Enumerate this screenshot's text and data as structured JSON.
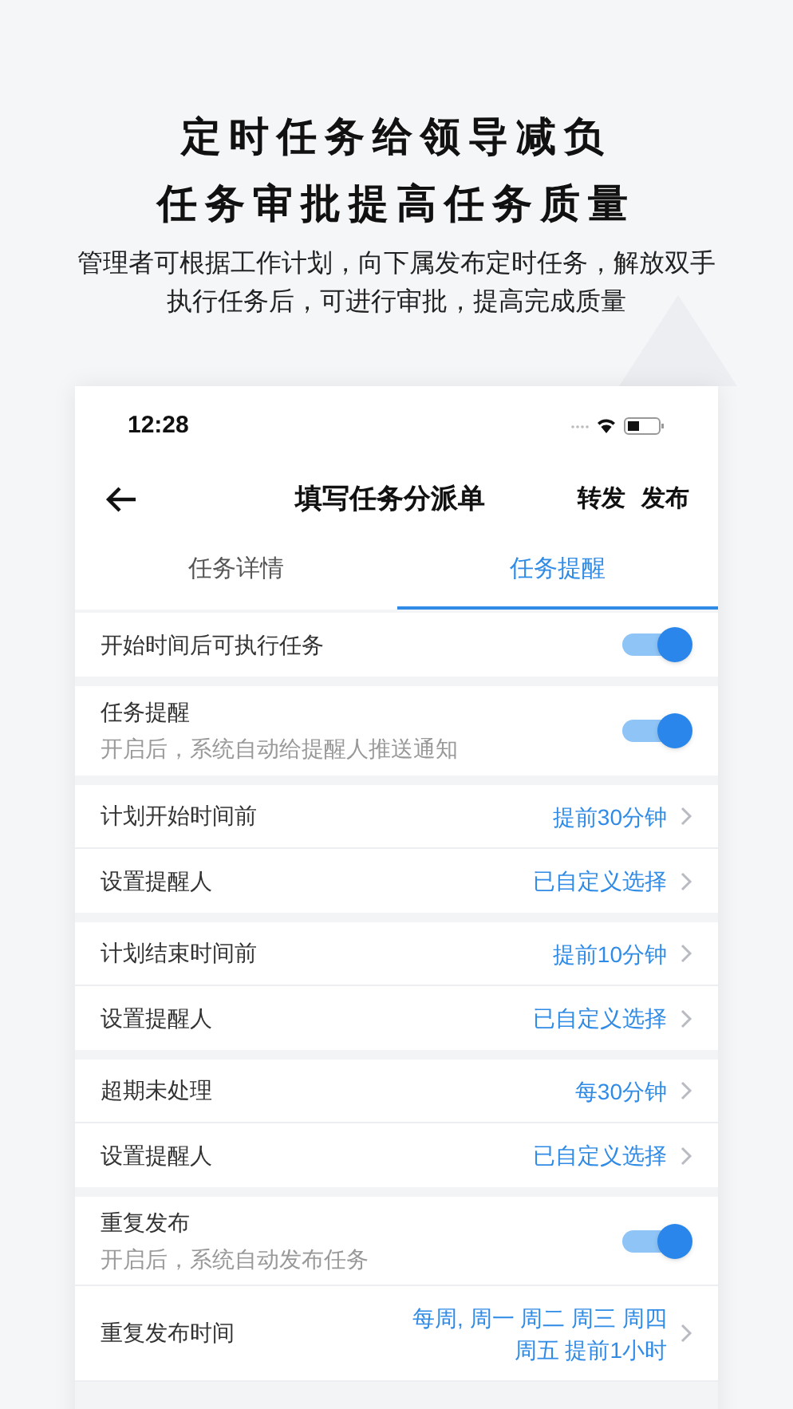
{
  "headline": [
    "定时任务给领导减负",
    "任务审批提高任务质量"
  ],
  "subtitle": [
    "管理者可根据工作计划，向下属发布定时任务，解放双手",
    "执行任务后，可进行审批，提高完成质量"
  ],
  "status_bar": {
    "time": "12:28"
  },
  "nav": {
    "title": "填写任务分派单",
    "actions": [
      "转发",
      "发布"
    ]
  },
  "tabs": [
    {
      "label": "任务详情",
      "selected": false
    },
    {
      "label": "任务提醒",
      "selected": true
    }
  ],
  "sections": [
    {
      "rows": [
        {
          "kind": "toggle",
          "label": "开始时间后可执行任务",
          "on": true
        }
      ]
    },
    {
      "rows": [
        {
          "kind": "toggle",
          "label": "任务提醒",
          "hint": "开启后，系统自动给提醒人推送通知",
          "on": true
        }
      ]
    },
    {
      "rows": [
        {
          "kind": "link",
          "label": "计划开始时间前",
          "value_lines": [
            "提前30分钟"
          ]
        },
        {
          "kind": "link",
          "label": "设置提醒人",
          "value_lines": [
            "已自定义选择"
          ]
        }
      ]
    },
    {
      "rows": [
        {
          "kind": "link",
          "label": "计划结束时间前",
          "value_lines": [
            "提前10分钟"
          ]
        },
        {
          "kind": "link",
          "label": "设置提醒人",
          "value_lines": [
            "已自定义选择"
          ]
        }
      ]
    },
    {
      "rows": [
        {
          "kind": "link",
          "label": "超期未处理",
          "value_lines": [
            "每30分钟"
          ]
        },
        {
          "kind": "link",
          "label": "设置提醒人",
          "value_lines": [
            "已自定义选择"
          ]
        }
      ]
    },
    {
      "rows": [
        {
          "kind": "toggle",
          "label": "重复发布",
          "hint": "开启后，系统自动发布任务",
          "on": true
        },
        {
          "kind": "link",
          "label": "重复发布时间",
          "value_lines": [
            "每周, 周一 周二 周三 周四",
            "周五 提前1小时"
          ]
        }
      ]
    }
  ]
}
